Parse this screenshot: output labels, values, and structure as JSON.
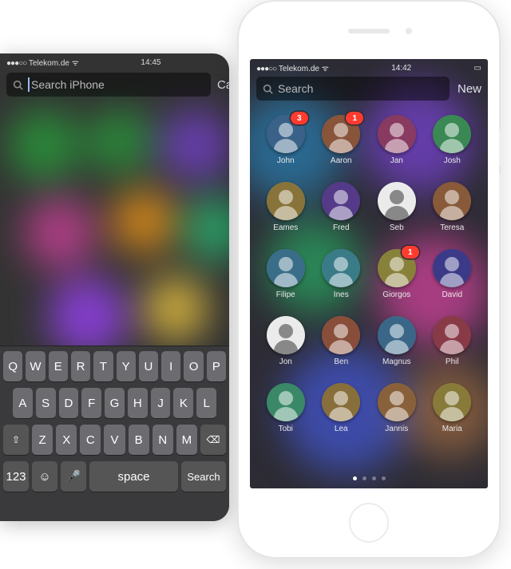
{
  "left": {
    "status": {
      "carrier": "Telekom.de",
      "time": "14:45"
    },
    "search": {
      "placeholder": "Search iPhone"
    },
    "cancel": "Cancel",
    "keyboard": {
      "row1": [
        "Q",
        "W",
        "E",
        "R",
        "T",
        "Y",
        "U",
        "I",
        "O",
        "P"
      ],
      "row2": [
        "A",
        "S",
        "D",
        "F",
        "G",
        "H",
        "J",
        "K",
        "L"
      ],
      "row3_shift": "⇧",
      "row3": [
        "Z",
        "X",
        "C",
        "V",
        "B",
        "N",
        "M"
      ],
      "row3_del": "⌫",
      "row4_123": "123",
      "row4_emoji": "☺",
      "row4_mic": "🎤",
      "row4_space": "space",
      "row4_search": "Search"
    }
  },
  "right": {
    "status": {
      "carrier": "Telekom.de",
      "time": "14:42"
    },
    "search": {
      "placeholder": "Search"
    },
    "new": "New",
    "page_count": 4,
    "active_page": 0,
    "contacts": [
      {
        "name": "John",
        "badge": 3,
        "hue": 210
      },
      {
        "name": "Aaron",
        "badge": 1,
        "hue": 20
      },
      {
        "name": "Jan",
        "badge": null,
        "hue": 330
      },
      {
        "name": "Josh",
        "badge": null,
        "hue": 140
      },
      {
        "name": "Eames",
        "badge": null,
        "hue": 45
      },
      {
        "name": "Fred",
        "badge": null,
        "hue": 260
      },
      {
        "name": "Seb",
        "badge": null,
        "hue": 0,
        "light": true
      },
      {
        "name": "Teresa",
        "badge": null,
        "hue": 25
      },
      {
        "name": "Filipe",
        "badge": null,
        "hue": 200
      },
      {
        "name": "Ines",
        "badge": null,
        "hue": 190
      },
      {
        "name": "Giorgos",
        "badge": 1,
        "hue": 55
      },
      {
        "name": "David",
        "badge": null,
        "hue": 240
      },
      {
        "name": "Jon",
        "badge": null,
        "hue": 0,
        "light": true
      },
      {
        "name": "Ben",
        "badge": null,
        "hue": 15
      },
      {
        "name": "Magnus",
        "badge": null,
        "hue": 205
      },
      {
        "name": "Phil",
        "badge": null,
        "hue": 350
      },
      {
        "name": "Tobi",
        "badge": null,
        "hue": 155
      },
      {
        "name": "Lea",
        "badge": null,
        "hue": 40
      },
      {
        "name": "Jannis",
        "badge": null,
        "hue": 30
      },
      {
        "name": "Maria",
        "badge": null,
        "hue": 50
      }
    ]
  }
}
